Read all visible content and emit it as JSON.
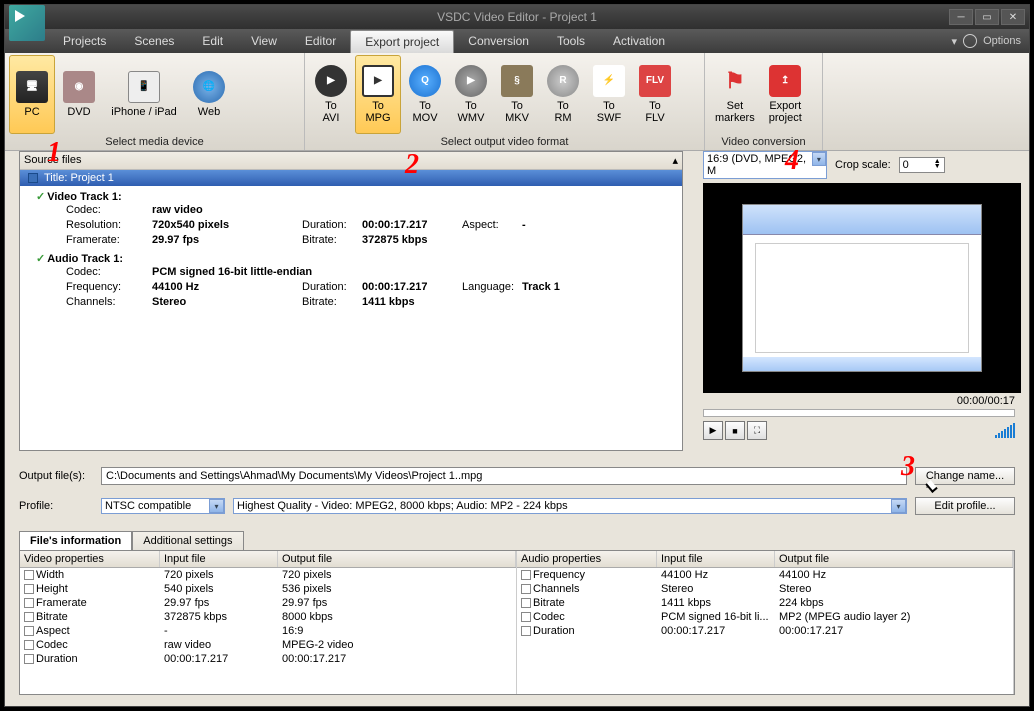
{
  "title": "VSDC Video Editor - Project 1",
  "options": "Options",
  "menus": [
    "Projects",
    "Scenes",
    "Edit",
    "View",
    "Editor",
    "Export project",
    "Conversion",
    "Tools",
    "Activation"
  ],
  "ribbon": {
    "g1": [
      {
        "lbl": "PC",
        "sel": true
      },
      {
        "lbl": "DVD"
      },
      {
        "lbl": "iPhone / iPad"
      },
      {
        "lbl": "Web"
      }
    ],
    "g1_footer": "Select media device",
    "g2": [
      {
        "lbl": "To\nAVI"
      },
      {
        "lbl": "To\nMPG",
        "sel": true
      },
      {
        "lbl": "To\nMOV"
      },
      {
        "lbl": "To\nWMV"
      },
      {
        "lbl": "To\nMKV"
      },
      {
        "lbl": "To\nRM"
      },
      {
        "lbl": "To\nSWF"
      },
      {
        "lbl": "To\nFLV"
      }
    ],
    "g2_footer": "Select output video format",
    "g3": [
      {
        "lbl": "Set\nmarkers"
      },
      {
        "lbl": "Export\nproject"
      }
    ],
    "g3_footer": "Video conversion"
  },
  "src": {
    "header": "Source files",
    "title": "Title: Project 1",
    "video_section": "Video Track 1:",
    "audio_section": "Audio Track 1:",
    "v": {
      "codec_l": "Codec:",
      "codec": "raw video",
      "res_l": "Resolution:",
      "res": "720x540 pixels",
      "dur_l": "Duration:",
      "dur": "00:00:17.217",
      "asp_l": "Aspect:",
      "asp": "-",
      "fr_l": "Framerate:",
      "fr": "29.97 fps",
      "br_l": "Bitrate:",
      "br": "372875 kbps"
    },
    "a": {
      "codec_l": "Codec:",
      "codec": "PCM signed 16-bit little-endian",
      "freq_l": "Frequency:",
      "freq": "44100 Hz",
      "dur_l": "Duration:",
      "dur": "00:00:17.217",
      "lang_l": "Language:",
      "lang": "Track 1",
      "ch_l": "Channels:",
      "ch": "Stereo",
      "br_l": "Bitrate:",
      "br": "1411 kbps"
    }
  },
  "preview": {
    "ratio": "16:9 (DVD, MPEG2, M",
    "crop_l": "Crop scale:",
    "crop": "0",
    "time": "00:00/00:17"
  },
  "output": {
    "label": "Output file(s):",
    "path": "C:\\Documents and Settings\\Ahmad\\My Documents\\My Videos\\Project 1..mpg",
    "change": "Change name...",
    "profile_l": "Profile:",
    "profile": "NTSC compatible",
    "quality": "Highest Quality - Video: MPEG2, 8000 kbps; Audio: MP2 - 224 kbps",
    "edit": "Edit profile..."
  },
  "tabs": [
    "File's information",
    "Additional settings"
  ],
  "vprops": {
    "h1": "Video properties",
    "h2": "Input file",
    "h3": "Output file",
    "rows": [
      {
        "n": "Width",
        "i": "720 pixels",
        "o": "720 pixels"
      },
      {
        "n": "Height",
        "i": "540 pixels",
        "o": "536 pixels"
      },
      {
        "n": "Framerate",
        "i": "29.97 fps",
        "o": "29.97 fps"
      },
      {
        "n": "Bitrate",
        "i": "372875 kbps",
        "o": "8000 kbps"
      },
      {
        "n": "Aspect",
        "i": "-",
        "o": "16:9"
      },
      {
        "n": "Codec",
        "i": "raw video",
        "o": "MPEG-2 video"
      },
      {
        "n": "Duration",
        "i": "00:00:17.217",
        "o": "00:00:17.217"
      }
    ]
  },
  "aprops": {
    "h1": "Audio properties",
    "h2": "Input file",
    "h3": "Output file",
    "rows": [
      {
        "n": "Frequency",
        "i": "44100 Hz",
        "o": "44100 Hz"
      },
      {
        "n": "Channels",
        "i": "Stereo",
        "o": "Stereo"
      },
      {
        "n": "Bitrate",
        "i": "1411 kbps",
        "o": "224 kbps"
      },
      {
        "n": "Codec",
        "i": "PCM signed 16-bit li...",
        "o": "MP2 (MPEG audio layer 2)"
      },
      {
        "n": "Duration",
        "i": "00:00:17.217",
        "o": "00:00:17.217"
      }
    ]
  },
  "annots": [
    "1",
    "2",
    "3",
    "4"
  ]
}
